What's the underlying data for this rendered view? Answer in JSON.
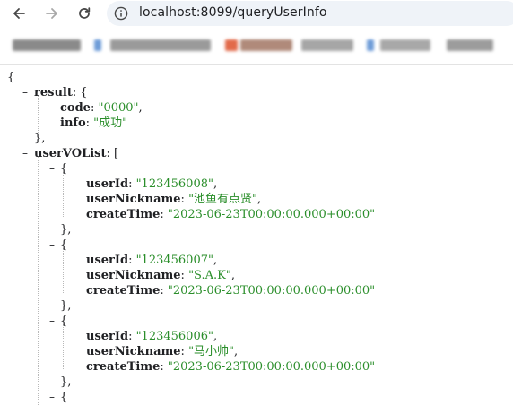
{
  "browser": {
    "url": "localhost:8099/queryUserInfo",
    "icons": {
      "back": "arrow-left-icon",
      "forward": "arrow-right-icon",
      "reload": "reload-icon",
      "site_info": "info-circle-icon"
    }
  },
  "json": {
    "open_brace": "{",
    "result_key": "result",
    "result": {
      "code_key": "code",
      "code_value": "\"0000\"",
      "info_key": "info",
      "info_value": "\"成功\""
    },
    "list_key": "userVOList",
    "users": [
      {
        "id_key": "userId",
        "id": "\"123456008\"",
        "nick_key": "userNickname",
        "nick": "\"池鱼有点贤\"",
        "time_key": "createTime",
        "time": "\"2023-06-23T00:00:00.000+00:00\""
      },
      {
        "id_key": "userId",
        "id": "\"123456007\"",
        "nick_key": "userNickname",
        "nick": "\"S.A.K\"",
        "time_key": "createTime",
        "time": "\"2023-06-23T00:00:00.000+00:00\""
      },
      {
        "id_key": "userId",
        "id": "\"123456006\"",
        "nick_key": "userNickname",
        "nick": "\"马小帅\"",
        "time_key": "createTime",
        "time": "\"2023-06-23T00:00:00.000+00:00\""
      }
    ]
  },
  "colors": {
    "string": "#2a8e2a",
    "key": "#202124",
    "omnibox": "#eff3f8"
  }
}
